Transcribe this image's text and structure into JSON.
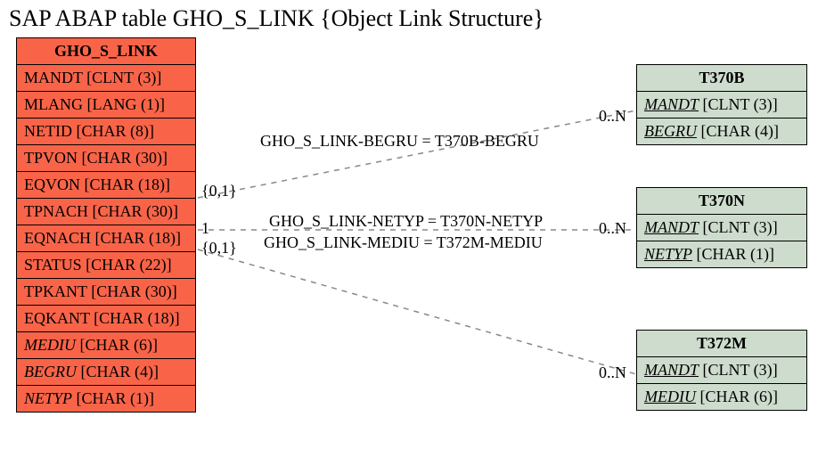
{
  "title": "SAP ABAP table GHO_S_LINK {Object Link Structure}",
  "main": {
    "name": "GHO_S_LINK",
    "fields": [
      {
        "name": "MANDT",
        "type": "CLNT (3)",
        "style": "plain"
      },
      {
        "name": "MLANG",
        "type": "LANG (1)",
        "style": "plain"
      },
      {
        "name": "NETID",
        "type": "CHAR (8)",
        "style": "plain"
      },
      {
        "name": "TPVON",
        "type": "CHAR (30)",
        "style": "plain"
      },
      {
        "name": "EQVON",
        "type": "CHAR (18)",
        "style": "plain"
      },
      {
        "name": "TPNACH",
        "type": "CHAR (30)",
        "style": "plain"
      },
      {
        "name": "EQNACH",
        "type": "CHAR (18)",
        "style": "plain"
      },
      {
        "name": "STATUS",
        "type": "CHAR (22)",
        "style": "plain"
      },
      {
        "name": "TPKANT",
        "type": "CHAR (30)",
        "style": "plain"
      },
      {
        "name": "EQKANT",
        "type": "CHAR (18)",
        "style": "plain"
      },
      {
        "name": "MEDIU",
        "type": "CHAR (6)",
        "style": "fk"
      },
      {
        "name": "BEGRU",
        "type": "CHAR (4)",
        "style": "fk"
      },
      {
        "name": "NETYP",
        "type": "CHAR (1)",
        "style": "fk"
      }
    ]
  },
  "side": [
    {
      "name": "T370B",
      "fields": [
        {
          "name": "MANDT",
          "type": "CLNT (3)",
          "style": "pk"
        },
        {
          "name": "BEGRU",
          "type": "CHAR (4)",
          "style": "pk"
        }
      ]
    },
    {
      "name": "T370N",
      "fields": [
        {
          "name": "MANDT",
          "type": "CLNT (3)",
          "style": "pk"
        },
        {
          "name": "NETYP",
          "type": "CHAR (1)",
          "style": "pk"
        }
      ]
    },
    {
      "name": "T372M",
      "fields": [
        {
          "name": "MANDT",
          "type": "CLNT (3)",
          "style": "pk"
        },
        {
          "name": "MEDIU",
          "type": "CHAR (6)",
          "style": "pk"
        }
      ]
    }
  ],
  "relations": [
    {
      "label": "GHO_S_LINK-BEGRU = T370B-BEGRU"
    },
    {
      "label": "GHO_S_LINK-NETYP = T370N-NETYP"
    },
    {
      "label": "GHO_S_LINK-MEDIU = T372M-MEDIU"
    }
  ],
  "cards": {
    "left1": "{0,1}",
    "left2": "1",
    "left3": "{0,1}",
    "right1": "0..N",
    "right2": "0..N",
    "right3": "0..N"
  }
}
